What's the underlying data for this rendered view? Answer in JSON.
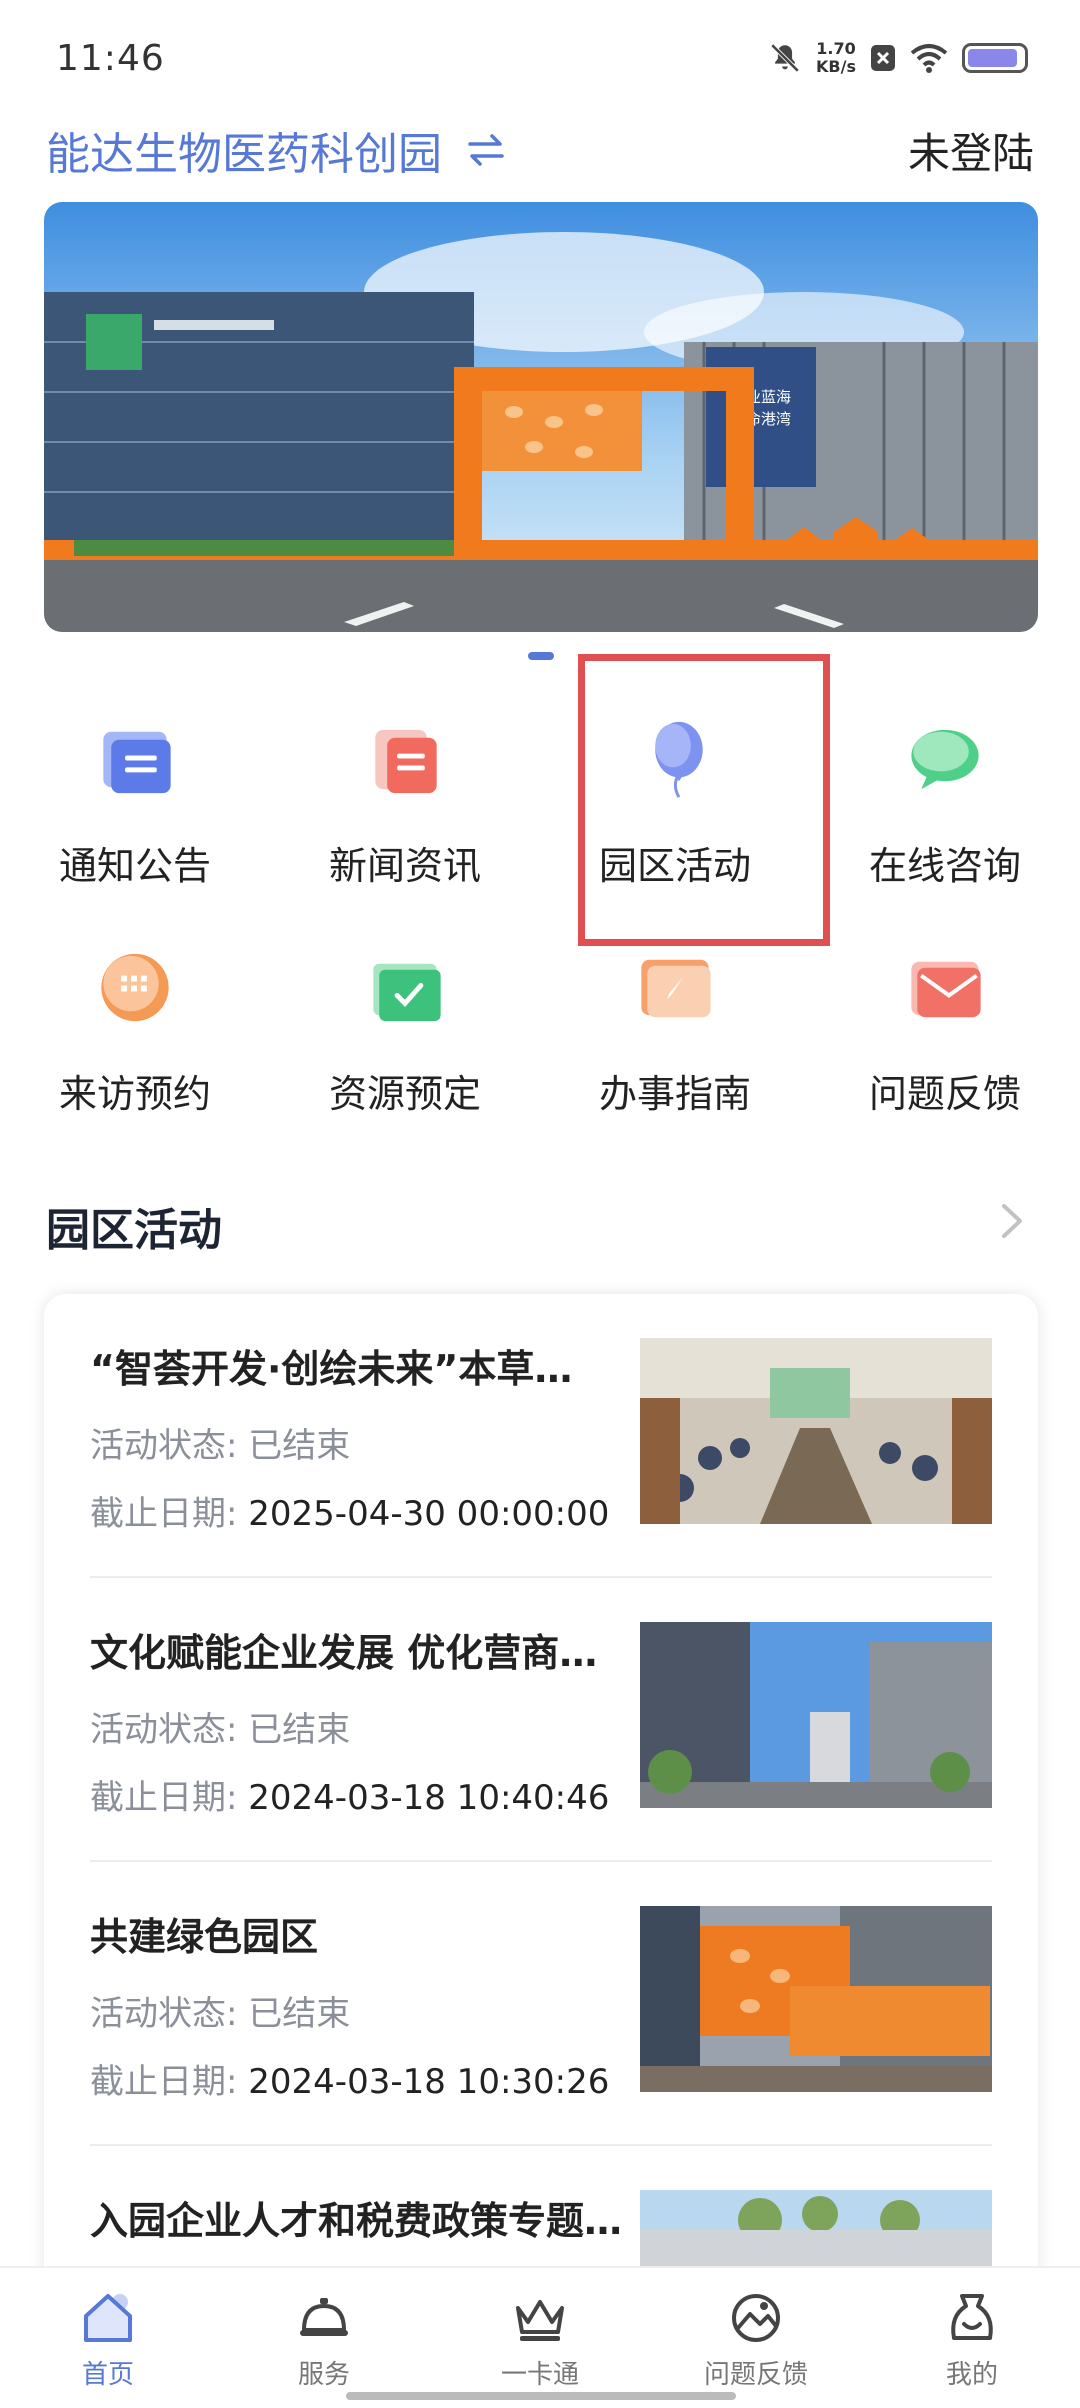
{
  "status": {
    "time": "11:46",
    "net_speed_value": "1.70",
    "net_speed_unit": "KB/s",
    "battery_level": 0.9
  },
  "header": {
    "park_name": "能达生物医药科创园",
    "login": "未登陆"
  },
  "banner": {
    "sign_line1": "产业蓝海",
    "sign_line2": "生命港湾"
  },
  "grid": [
    {
      "label": "通知公告",
      "icon": "notice-icon"
    },
    {
      "label": "新闻资讯",
      "icon": "news-icon"
    },
    {
      "label": "园区活动",
      "icon": "balloon-icon"
    },
    {
      "label": "在线咨询",
      "icon": "chat-icon"
    },
    {
      "label": "来访预约",
      "icon": "calendar-icon"
    },
    {
      "label": "资源预定",
      "icon": "booking-icon"
    },
    {
      "label": "办事指南",
      "icon": "guide-icon"
    },
    {
      "label": "问题反馈",
      "icon": "mail-icon"
    }
  ],
  "section": {
    "title": "园区活动"
  },
  "activities": [
    {
      "title": "“智荟开发·创绘未来”本草…",
      "status_label": "活动状态:",
      "status": "已结束",
      "deadline_label": "截止日期:",
      "deadline": "2025-04-30 00:00:00"
    },
    {
      "title": "文化赋能企业发展 优化营商…",
      "status_label": "活动状态:",
      "status": "已结束",
      "deadline_label": "截止日期:",
      "deadline": "2024-03-18 10:40:46"
    },
    {
      "title": "共建绿色园区",
      "status_label": "活动状态:",
      "status": "已结束",
      "deadline_label": "截止日期:",
      "deadline": "2024-03-18 10:30:26"
    },
    {
      "title": "入园企业人才和税费政策专题…",
      "status_label": "",
      "status": "",
      "deadline_label": "",
      "deadline": ""
    }
  ],
  "nav": [
    {
      "label": "首页",
      "icon": "home-icon",
      "active": true
    },
    {
      "label": "服务",
      "icon": "service-bell-icon",
      "active": false
    },
    {
      "label": "一卡通",
      "icon": "crown-icon",
      "active": false
    },
    {
      "label": "问题反馈",
      "icon": "feedback-icon",
      "active": false
    },
    {
      "label": "我的",
      "icon": "user-bag-icon",
      "active": false
    }
  ]
}
